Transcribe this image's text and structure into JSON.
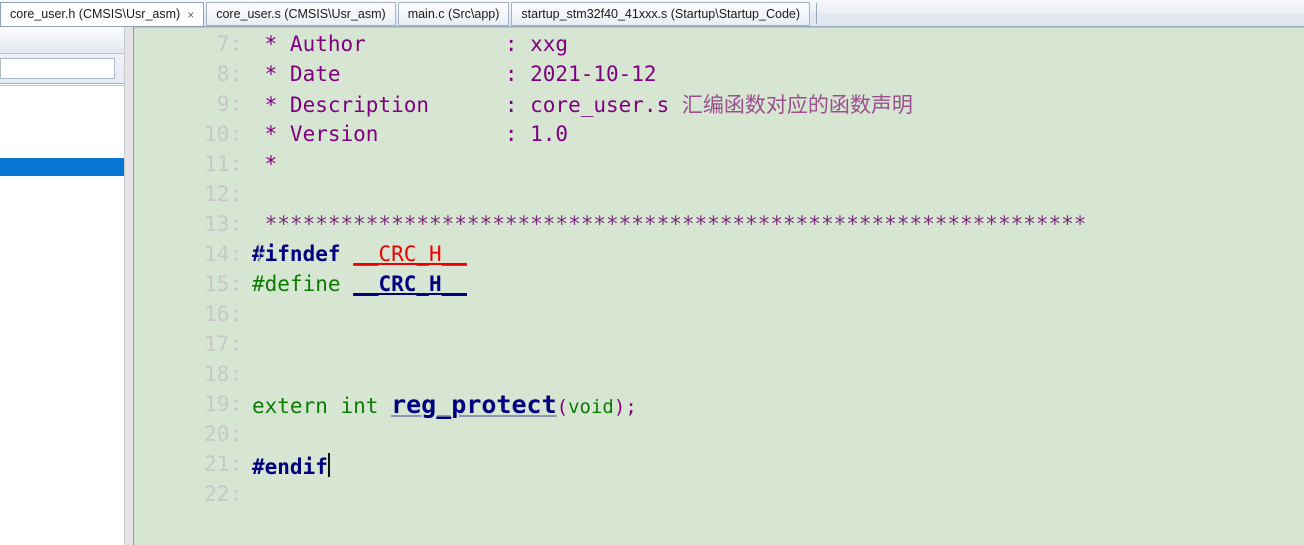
{
  "window": {
    "editor_bg": "#d6e6d2",
    "selection_blue": "#0a76d4"
  },
  "tabbar": {
    "tabs": [
      {
        "label": "core_user.h (CMSIS\\Usr_asm)",
        "active": true,
        "close_icon": "×"
      },
      {
        "label": "core_user.s (CMSIS\\Usr_asm)",
        "active": false
      },
      {
        "label": "main.c (Src\\app)",
        "active": false
      },
      {
        "label": "startup_stm32f40_41xxx.s (Startup\\Startup_Code)",
        "active": false
      }
    ]
  },
  "left_panel": {
    "search_value": "",
    "search_placeholder": "",
    "rows": [
      {
        "label": "",
        "selected": false
      },
      {
        "label": "",
        "selected": false
      },
      {
        "label": "",
        "selected": false
      },
      {
        "label": "",
        "selected": false
      },
      {
        "label": "",
        "selected": true
      },
      {
        "label": "",
        "selected": false
      },
      {
        "label": "",
        "selected": false
      }
    ]
  },
  "editor": {
    "first_line": 7,
    "lines": [
      {
        "num": "7:",
        "segments": [
          {
            "text": " * Author           : xxg",
            "cls": "tok-comment"
          }
        ]
      },
      {
        "num": "8:",
        "segments": [
          {
            "text": " * Date             : 2021-10-12",
            "cls": "tok-comment"
          }
        ]
      },
      {
        "num": "9:",
        "segments": [
          {
            "text": " * Description      : core_user.s ",
            "cls": "tok-comment"
          },
          {
            "text": "汇编函数对应的函数声明",
            "cls": "tok-comment-cn"
          }
        ]
      },
      {
        "num": "10:",
        "segments": [
          {
            "text": " * Version          : 1.0",
            "cls": "tok-comment"
          }
        ]
      },
      {
        "num": "11:",
        "segments": [
          {
            "text": " *",
            "cls": "tok-comment"
          }
        ]
      },
      {
        "num": "12:",
        "segments": [
          {
            "text": "",
            "cls": "tok-comment"
          }
        ]
      },
      {
        "num": "13:",
        "segments": [
          {
            "text": " *****************************************************************",
            "cls": "tok-stars"
          }
        ]
      },
      {
        "num": "14:",
        "segments": [
          {
            "text": "#ifndef",
            "cls": "tok-pp-navy"
          },
          {
            "text": " ",
            "cls": ""
          },
          {
            "text": "__CRC_H__",
            "cls": "tok-macro-red"
          }
        ],
        "fold": "├"
      },
      {
        "num": "15:",
        "segments": [
          {
            "text": "#define",
            "cls": "tok-pp-green"
          },
          {
            "text": " ",
            "cls": ""
          },
          {
            "text": "__CRC_H__",
            "cls": "tok-macro-navy"
          }
        ]
      },
      {
        "num": "16:",
        "segments": [
          {
            "text": "",
            "cls": ""
          }
        ]
      },
      {
        "num": "17:",
        "segments": [
          {
            "text": "",
            "cls": ""
          }
        ]
      },
      {
        "num": "18:",
        "segments": [
          {
            "text": "",
            "cls": ""
          }
        ]
      },
      {
        "num": "19:",
        "segments": [
          {
            "text": "extern int ",
            "cls": "tok-keyword"
          },
          {
            "text": "reg_protect",
            "cls": "tok-func"
          },
          {
            "text": "(",
            "cls": "tok-paren"
          },
          {
            "text": "void",
            "cls": "tok-void"
          },
          {
            "text": ");",
            "cls": "tok-paren"
          }
        ]
      },
      {
        "num": "20:",
        "segments": [
          {
            "text": "",
            "cls": ""
          }
        ]
      },
      {
        "num": "21:",
        "segments": [
          {
            "text": "#endif",
            "cls": "tok-pp-navy"
          }
        ],
        "caret": true
      },
      {
        "num": "22:",
        "segments": [
          {
            "text": "",
            "cls": ""
          }
        ]
      }
    ]
  }
}
